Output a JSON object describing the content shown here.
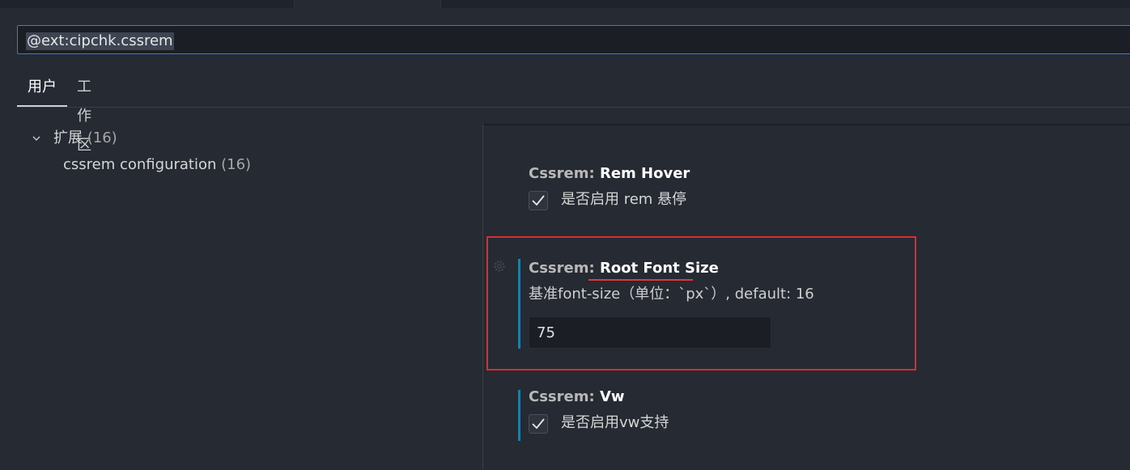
{
  "search": {
    "query": "@ext:cipchk.cssrem"
  },
  "scope_tabs": [
    {
      "label": "用户"
    },
    {
      "label": "工作区"
    }
  ],
  "toc": {
    "group": {
      "label": "扩展",
      "count": "(16)"
    },
    "items": [
      {
        "label": "cssrem configuration",
        "count": "(16)"
      }
    ]
  },
  "settings": [
    {
      "category": "Cssrem:",
      "name": "Rem Hover",
      "checkbox_label": "是否启用 rem 悬停",
      "checked": true
    },
    {
      "category": "Cssrem:",
      "name": "Root Font Size",
      "description": "基准font-size（单位：`px`）, default: 16",
      "value": "75"
    },
    {
      "category": "Cssrem:",
      "name": "Vw",
      "checkbox_label": "是否启用vw支持",
      "checked": true
    }
  ],
  "colors": {
    "accent": "#3b7bd8",
    "modified_bar": "#1e7fa6",
    "annotation": "#e02b2b"
  },
  "icons": {
    "chevron": "chevron-down-icon",
    "check": "check-icon",
    "gear": "gear-icon"
  }
}
